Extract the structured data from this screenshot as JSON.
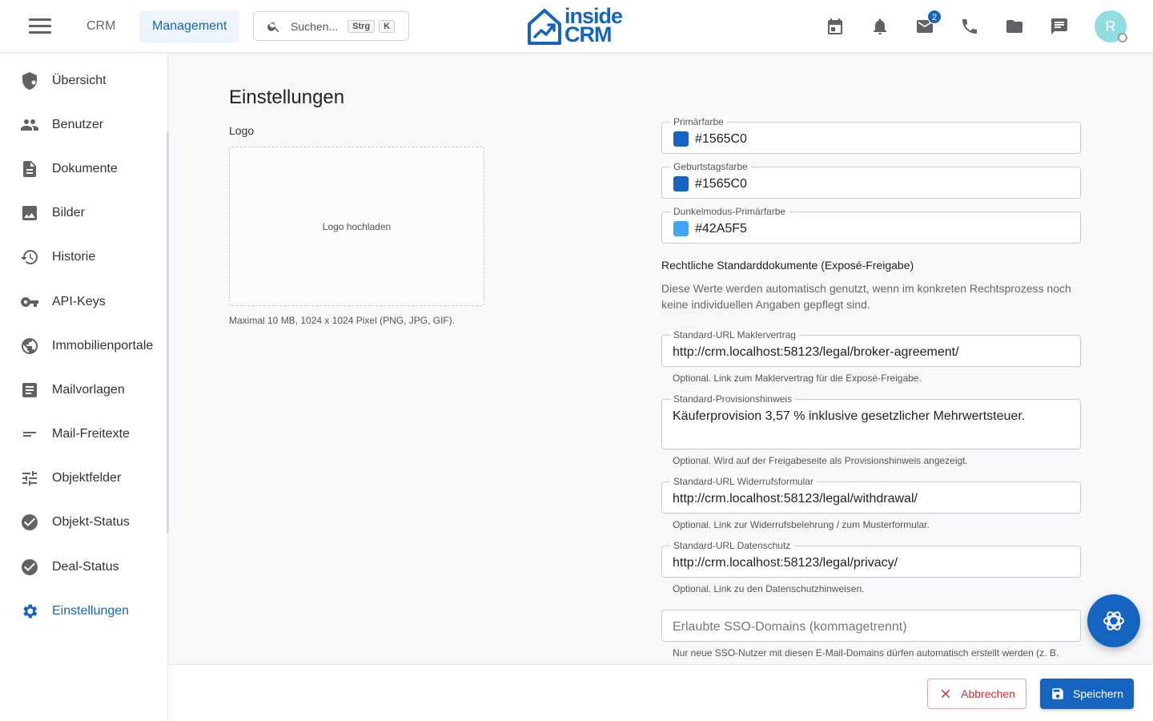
{
  "header": {
    "nav_tabs": [
      {
        "label": "CRM"
      },
      {
        "label": "Management"
      }
    ],
    "search": {
      "placeholder": "Suchen...",
      "kbd_1": "Strg",
      "kbd_2": "K"
    },
    "logo_line1": "inside",
    "logo_line2": "CRM",
    "mail_badge": "2",
    "avatar_letter": "R",
    "icons": [
      "calendar-icon",
      "bell-icon",
      "mail-icon",
      "phone-icon",
      "folder-icon",
      "chat-icon"
    ]
  },
  "sidebar": {
    "items": [
      {
        "label": "Übersicht",
        "icon": "shield-icon"
      },
      {
        "label": "Benutzer",
        "icon": "people-icon"
      },
      {
        "label": "Dokumente",
        "icon": "document-icon"
      },
      {
        "label": "Bilder",
        "icon": "image-icon"
      },
      {
        "label": "Historie",
        "icon": "history-icon"
      },
      {
        "label": "API-Keys",
        "icon": "key-icon"
      },
      {
        "label": "Immobilienportale",
        "icon": "globe-icon"
      },
      {
        "label": "Mailvorlagen",
        "icon": "article-icon"
      },
      {
        "label": "Mail-Freitexte",
        "icon": "short-text-icon"
      },
      {
        "label": "Objektfelder",
        "icon": "tune-icon"
      },
      {
        "label": "Objekt-Status",
        "icon": "check-circle-icon"
      },
      {
        "label": "Deal-Status",
        "icon": "check-circle-icon"
      },
      {
        "label": "Einstellungen",
        "icon": "gear-icon",
        "active": true
      }
    ]
  },
  "main": {
    "title": "Einstellungen",
    "logo_label": "Logo",
    "upload_text": "Logo hochladen",
    "upload_hint": "Maximal 10 MB, 1024 x 1024 Pixel (PNG, JPG, GIF).",
    "colors": [
      {
        "label": "Primärfarbe",
        "value": "#1565C0",
        "swatch": "#1565C0"
      },
      {
        "label": "Geburtstagsfarbe",
        "value": "#1565C0",
        "swatch": "#1565C0"
      },
      {
        "label": "Dunkelmodus-Primärfarbe",
        "value": "#42A5F5",
        "swatch": "#42A5F5"
      }
    ],
    "legal_title": "Rechtliche Standarddokumente (Exposé-Freigabe)",
    "legal_desc": "Diese Werte werden automatisch genutzt, wenn im konkreten Rechtsprozess noch keine individuellen Angaben gepflegt sind.",
    "legal_fields": [
      {
        "label": "Standard-URL Maklervertrag",
        "value": "http://crm.localhost:58123/legal/broker-agreement/",
        "helper": "Optional. Link zum Maklervertrag für die Exposé-Freigabe."
      },
      {
        "label": "Standard-Provisionshinweis",
        "value": "Käuferprovision 3,57 % inklusive gesetzlicher Mehrwertsteuer.",
        "helper": "Optional. Wird auf der Freigabeseite als Provisionshinweis angezeigt."
      },
      {
        "label": "Standard-URL Widerrufsformular",
        "value": "http://crm.localhost:58123/legal/withdrawal/",
        "helper": "Optional. Link zur Widerrufsbelehrung / zum Musterformular."
      },
      {
        "label": "Standard-URL Datenschutz",
        "value": "http://crm.localhost:58123/legal/privacy/",
        "helper": "Optional. Link zu den Datenschutzhinweisen."
      }
    ],
    "sso_placeholder": "Erlaubte SSO-Domains (kommagetrennt)",
    "sso_helper": "Nur neue SSO-Nutzer mit diesen E-Mail-Domains dürfen automatisch erstellt werden (z. B."
  },
  "footer": {
    "cancel_label": "Abbrechen",
    "save_label": "Speichern"
  },
  "colors": {
    "accent": "#1565C0",
    "danger": "#D32F2F",
    "avatar": "#8FDDE0"
  }
}
